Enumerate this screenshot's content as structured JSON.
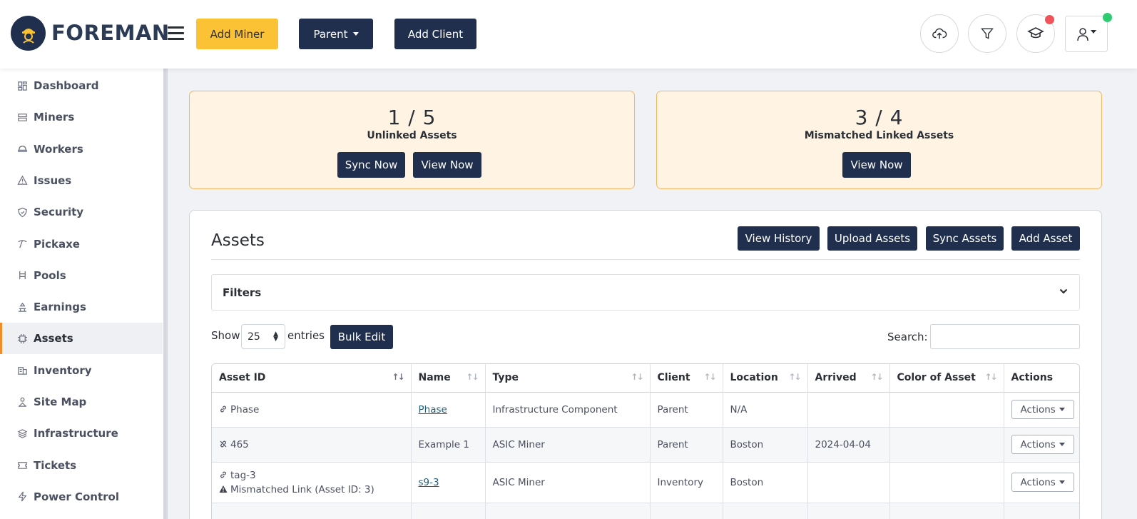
{
  "header": {
    "logo_text": "FOREMAN",
    "add_miner_label": "Add Miner",
    "parent_label": "Parent",
    "add_client_label": "Add Client"
  },
  "sidebar": {
    "items": [
      {
        "label": "Dashboard",
        "icon": "dashboard-icon"
      },
      {
        "label": "Miners",
        "icon": "miners-icon"
      },
      {
        "label": "Workers",
        "icon": "workers-icon"
      },
      {
        "label": "Issues",
        "icon": "warning-icon"
      },
      {
        "label": "Security",
        "icon": "shield-icon"
      },
      {
        "label": "Pickaxe",
        "icon": "pickaxe-icon"
      },
      {
        "label": "Pools",
        "icon": "pools-icon"
      },
      {
        "label": "Earnings",
        "icon": "earnings-icon"
      },
      {
        "label": "Assets",
        "icon": "assets-icon",
        "active": true
      },
      {
        "label": "Inventory",
        "icon": "inventory-icon"
      },
      {
        "label": "Site Map",
        "icon": "sitemap-icon"
      },
      {
        "label": "Infrastructure",
        "icon": "layers-icon"
      },
      {
        "label": "Tickets",
        "icon": "ticket-icon"
      },
      {
        "label": "Power Control",
        "icon": "bolt-icon"
      }
    ]
  },
  "cards": {
    "unlinked": {
      "count": "1 / 5",
      "label": "Unlinked Assets",
      "sync_label": "Sync Now",
      "view_label": "View Now"
    },
    "mismatched": {
      "count": "3 / 4",
      "label": "Mismatched Linked Assets",
      "view_label": "View Now"
    }
  },
  "assets": {
    "title": "Assets",
    "view_history_label": "View History",
    "upload_label": "Upload Assets",
    "sync_label": "Sync Assets",
    "add_label": "Add Asset",
    "filters_label": "Filters",
    "show_label": "Show",
    "entries_value": "25",
    "entries_label": "entries",
    "bulk_edit_label": "Bulk Edit",
    "search_label": "Search:",
    "search_value": ""
  },
  "table": {
    "columns": [
      "Asset ID",
      "Name",
      "Type",
      "Client",
      "Location",
      "Arrived",
      "Color of Asset",
      "Actions"
    ],
    "rows": [
      {
        "asset_id": "Phase",
        "name": "Phase",
        "type": "Infrastructure Component",
        "client": "Parent",
        "location": "N/A",
        "arrived": "",
        "color": "",
        "actions": "Actions"
      },
      {
        "asset_id": "465",
        "name": "Example 1",
        "type": "ASIC Miner",
        "client": "Parent",
        "location": "Boston",
        "arrived": "2024-04-04",
        "color": "",
        "actions": "Actions"
      },
      {
        "asset_id": "tag-3",
        "warning": "Mismatched Link (Asset ID: 3)",
        "name": "s9-3",
        "type": "ASIC Miner",
        "client": "Inventory",
        "location": "Boston",
        "arrived": "",
        "color": "",
        "actions": "Actions"
      }
    ]
  },
  "colors": {
    "navy": "#1f2f4d",
    "yellow": "#fcc236",
    "active_accent": "#f28c28",
    "warning_bg": "#fff4e3",
    "notif_red": "#f0535c",
    "notif_green": "#2ecc71"
  }
}
